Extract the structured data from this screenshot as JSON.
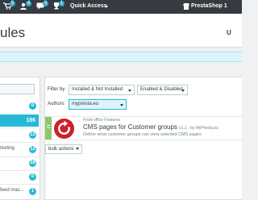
{
  "topbar": {
    "badges": [
      "5",
      "4",
      "0",
      "1"
    ],
    "quick_access": "Quick Access",
    "shop_name": "PrestaShop 1"
  },
  "header": {
    "title": "ules",
    "util_label": "U"
  },
  "left_panel": {
    "items": [
      {
        "label": "",
        "count": "0"
      },
      {
        "label": "",
        "count": "186"
      },
      {
        "label": "",
        "count": "13"
      },
      {
        "label": "rketing",
        "count": "12"
      },
      {
        "label": "",
        "count": "28"
      },
      {
        "label": "",
        "count": "0"
      },
      {
        "label": "feed mas...",
        "count": "1"
      }
    ]
  },
  "filters": {
    "filter_by_label": "Filter by",
    "installed_select": "Installed & Not Installed",
    "enabled_select": "Enabled & Disabled",
    "authors_label": "Authors",
    "authors_select": "mypresta.eu"
  },
  "module": {
    "category": "Front office Features",
    "name": "CMS pages for Customer groups",
    "version": "v1.1 - by MyPresta.eu",
    "description": "Define what customer groups can view selected CMS pages"
  },
  "bulk_actions": "bulk actions",
  "colors": {
    "topbar": "#363a41",
    "accent": "#25b9d7",
    "enabled_green": "#8fc66a",
    "logo_red": "#cf1f2a"
  }
}
